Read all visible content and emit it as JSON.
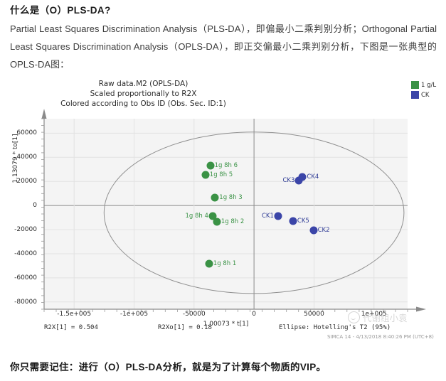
{
  "article": {
    "heading": "什么是（O）PLS-DA?",
    "paragraph": "Partial Least Squares Discrimination Analysis（PLS-DA），即偏最小二乘判别分析；Orthogonal Partial Least Squares Discrimination Analysis（OPLS-DA），即正交偏最小二乘判别分析，下图是一张典型的OPLS-DA图：",
    "footer_note": "你只需要记住：进行（O）PLS-DA分析，就是为了计算每个物质的VIP。"
  },
  "watermark": {
    "text": "代谢组小袁",
    "logo_icon": "circle-smile-icon"
  },
  "chart_data": {
    "type": "scatter",
    "title_lines": [
      "Raw data.M2 (OPLS-DA)",
      "Scaled proportionally to R2X",
      "Colored according to Obs ID (Obs. Sec. ID:1)"
    ],
    "xlabel": "1.00073 * t[1]",
    "ylabel": "1.13079 * to[1]",
    "xlim": [
      -175000,
      128000
    ],
    "ylim": [
      -86000,
      72000
    ],
    "grid": true,
    "legend_position": "top-right",
    "x_ticks": [
      {
        "value": -150000,
        "label": "-1.5e+005"
      },
      {
        "value": -100000,
        "label": "-1e+005"
      },
      {
        "value": -50000,
        "label": "-50000"
      },
      {
        "value": 0,
        "label": "0"
      },
      {
        "value": 50000,
        "label": "50000"
      },
      {
        "value": 100000,
        "label": "1e+005"
      }
    ],
    "y_ticks": [
      {
        "value": 60000,
        "label": "60000"
      },
      {
        "value": 40000,
        "label": "40000"
      },
      {
        "value": 20000,
        "label": "20000"
      },
      {
        "value": 0,
        "label": "0"
      },
      {
        "value": -20000,
        "label": "-20000"
      },
      {
        "value": -40000,
        "label": "-40000"
      },
      {
        "value": -60000,
        "label": "-60000"
      },
      {
        "value": -80000,
        "label": "-80000"
      }
    ],
    "legend": [
      {
        "label": "1 g/L",
        "color": "#3a9245"
      },
      {
        "label": "CK",
        "color": "#3b45a8"
      }
    ],
    "ellipse": {
      "label": "Hotelling's T2 (95%)",
      "center_x": 0,
      "center_y": -6000,
      "radius_x": 125000,
      "radius_y": 67000
    },
    "series": [
      {
        "name": "1 g/L",
        "color": "#3a9245",
        "points": [
          {
            "label": "1g 8h 6",
            "x": -36500,
            "y": 33000,
            "label_side": "right"
          },
          {
            "label": "1g 8h 5",
            "x": -40500,
            "y": 25500,
            "label_side": "right"
          },
          {
            "label": "1g 8h 3",
            "x": -32500,
            "y": 6800,
            "label_side": "right"
          },
          {
            "label": "1g 8h 4",
            "x": -34500,
            "y": -8500,
            "label_side": "left"
          },
          {
            "label": "1g 8h 2",
            "x": -31000,
            "y": -13500,
            "label_side": "right"
          },
          {
            "label": "1g 8h 1",
            "x": -37500,
            "y": -48000,
            "label_side": "right"
          }
        ]
      },
      {
        "name": "CK",
        "color": "#3b45a8",
        "points": [
          {
            "label": "CK3",
            "x": 37500,
            "y": 21000,
            "label_side": "left"
          },
          {
            "label": "CK4",
            "x": 40500,
            "y": 23500,
            "label_side": "right"
          },
          {
            "label": "CK1",
            "x": 20000,
            "y": -9000,
            "label_side": "left"
          },
          {
            "label": "CK5",
            "x": 32500,
            "y": -13000,
            "label_side": "right"
          },
          {
            "label": "CK2",
            "x": 49500,
            "y": -20500,
            "label_side": "right"
          }
        ]
      }
    ],
    "annotations": [
      "R2X[1] = 0.504",
      "R2Xo[1] = 0.18",
      "Ellipse: Hotelling's T2 (95%)"
    ],
    "stamp": "SIMCA 14 - 4/13/2018 8:40:26 PM (UTC+8)"
  }
}
